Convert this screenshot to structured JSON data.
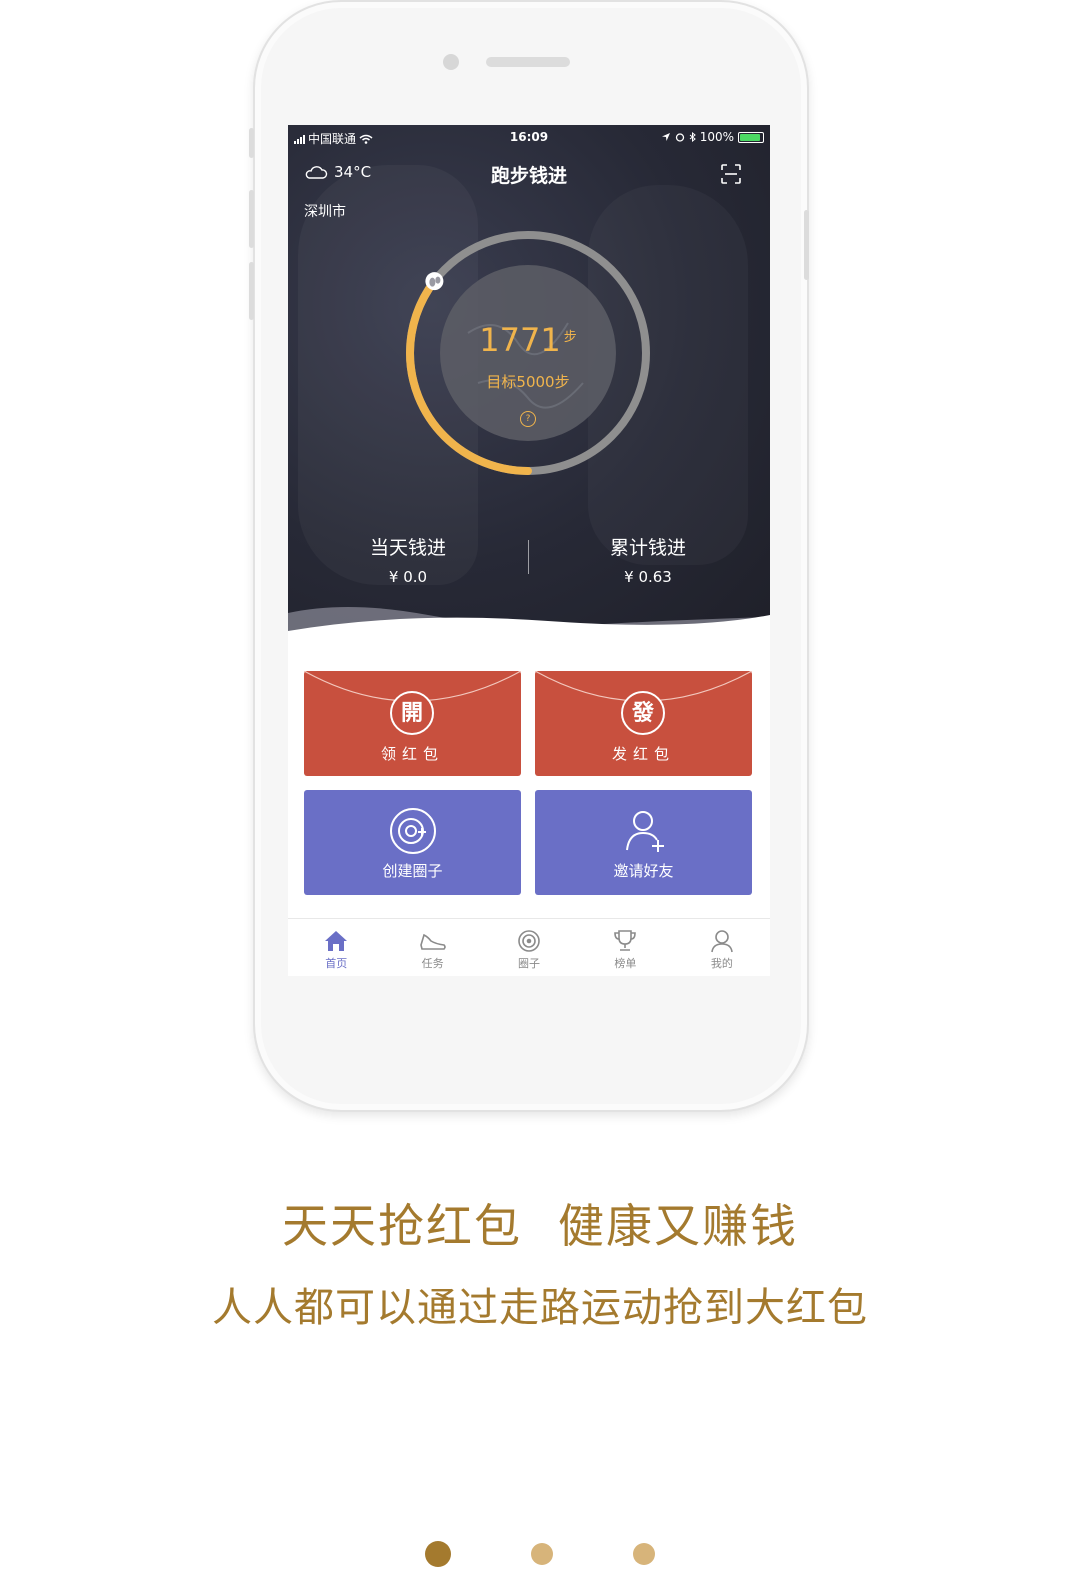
{
  "status_bar": {
    "carrier": "中国联通",
    "time": "16:09",
    "battery": "100%"
  },
  "header": {
    "temperature": "34°C",
    "city": "深圳市",
    "title": "跑步钱进"
  },
  "progress": {
    "steps": "1771",
    "steps_unit": "步",
    "goal_label": "目标5000步",
    "help_symbol": "?",
    "steps_value": 1771,
    "goal_value": 5000,
    "ring_color": "#f0b44c",
    "track_color": "#8f8f8f"
  },
  "stats": {
    "today_label": "当天钱进",
    "today_value": "¥ 0.0",
    "total_label": "累计钱进",
    "total_value": "¥ 0.63"
  },
  "cards": {
    "receive": {
      "seal": "開",
      "label": "领红包"
    },
    "send": {
      "seal": "發",
      "label": "发红包"
    },
    "create_circle": {
      "label": "创建圈子"
    },
    "invite": {
      "label": "邀请好友"
    },
    "red_color": "#c8503e",
    "blue_color": "#6a6fc6"
  },
  "tabs": [
    {
      "label": "首页",
      "icon": "home-icon",
      "active": true
    },
    {
      "label": "任务",
      "icon": "shoe-icon",
      "active": false
    },
    {
      "label": "圈子",
      "icon": "circle-target-icon",
      "active": false
    },
    {
      "label": "榜单",
      "icon": "trophy-icon",
      "active": false
    },
    {
      "label": "我的",
      "icon": "user-icon",
      "active": false
    }
  ],
  "caption": {
    "headline_a": "天天抢红包",
    "headline_b": "健康又赚钱",
    "subline": "人人都可以通过走路运动抢到大红包"
  },
  "pager": {
    "count": 3,
    "active_index": 0
  },
  "accent": "#a47a2e"
}
